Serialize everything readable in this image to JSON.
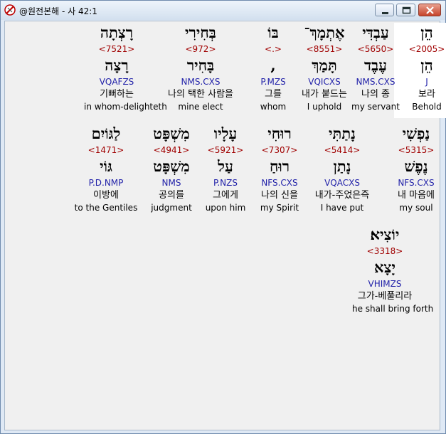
{
  "window": {
    "title": "@원전본해 - 사 42:1",
    "controls": [
      "minimize-icon",
      "maximize-icon",
      "close-icon"
    ]
  },
  "colors": {
    "strong": "#a00000",
    "parse": "#1f1fa8",
    "highlight": "#ffffff"
  },
  "rows": [
    [
      {
        "h1": "הֵן",
        "strong": "<2005>",
        "h2": "הֵן",
        "parse": "J",
        "kor": "보라",
        "eng": "Behold",
        "highlight": true
      },
      {
        "h1": "עַבְדִּי",
        "strong": "<5650>",
        "h2": "עֶבֶד",
        "parse": "NMS.CXS",
        "kor": "나의 종",
        "eng": "my servant"
      },
      {
        "h1": "אֶתְמָךְ־",
        "strong": "<8551>",
        "h2": "תָּמַךְ",
        "parse": "VQICXS",
        "kor": "내가 붙드는",
        "eng": "I uphold"
      },
      {
        "h1": "בּוֹ",
        "strong": "<.>",
        "h2": ",",
        "parse": "P.MZS",
        "kor": "그를",
        "eng": "whom"
      },
      {
        "h1": "בְּחִירִי",
        "strong": "<972>",
        "h2": "בָּחִיר",
        "parse": "NMS.CXS",
        "kor": "나의 택한 사람을",
        "eng": "mine elect"
      },
      {
        "h1": "רָצְתָה",
        "strong": "<7521>",
        "h2": "רָצָה",
        "parse": "VQAFZS",
        "kor": "기뻐하는",
        "eng": "in whom-delighteth"
      }
    ],
    [
      {
        "h1": "נַפְשִׁי",
        "strong": "<5315>",
        "h2": "נֶפֶשׁ",
        "parse": "NFS.CXS",
        "kor": "내 마음에",
        "eng": "my soul"
      },
      {
        "h1": "נָתַתִּי",
        "strong": "<5414>",
        "h2": "נָתַן",
        "parse": "VQACXS",
        "kor": "내가-주었은즉",
        "eng": "I have put"
      },
      {
        "h1": "רוּחִי",
        "strong": "<7307>",
        "h2": "רוּחַ",
        "parse": "NFS.CXS",
        "kor": "나의 신을",
        "eng": "my Spirit"
      },
      {
        "h1": "עָלָיו",
        "strong": "<5921>",
        "h2": "עַל",
        "parse": "P.NZS",
        "kor": "그에게",
        "eng": "upon him"
      },
      {
        "h1": "מִשְׁפָּט",
        "strong": "<4941>",
        "h2": "מִשְׁפָּט",
        "parse": "NMS",
        "kor": "공의를",
        "eng": "judgment"
      },
      {
        "h1": "לַגּוֹיִם",
        "strong": "<1471>",
        "h2": "גּוֹי",
        "parse": "P.D.NMP",
        "kor": "이방에",
        "eng": "to the Gentiles"
      }
    ],
    [
      {
        "h1": "יוֹצִיא׃",
        "strong": "<3318>",
        "h2": "יָצָא",
        "parse": "VHIMZS",
        "kor": "그가-베풀리라",
        "eng": "he shall bring forth"
      }
    ]
  ]
}
